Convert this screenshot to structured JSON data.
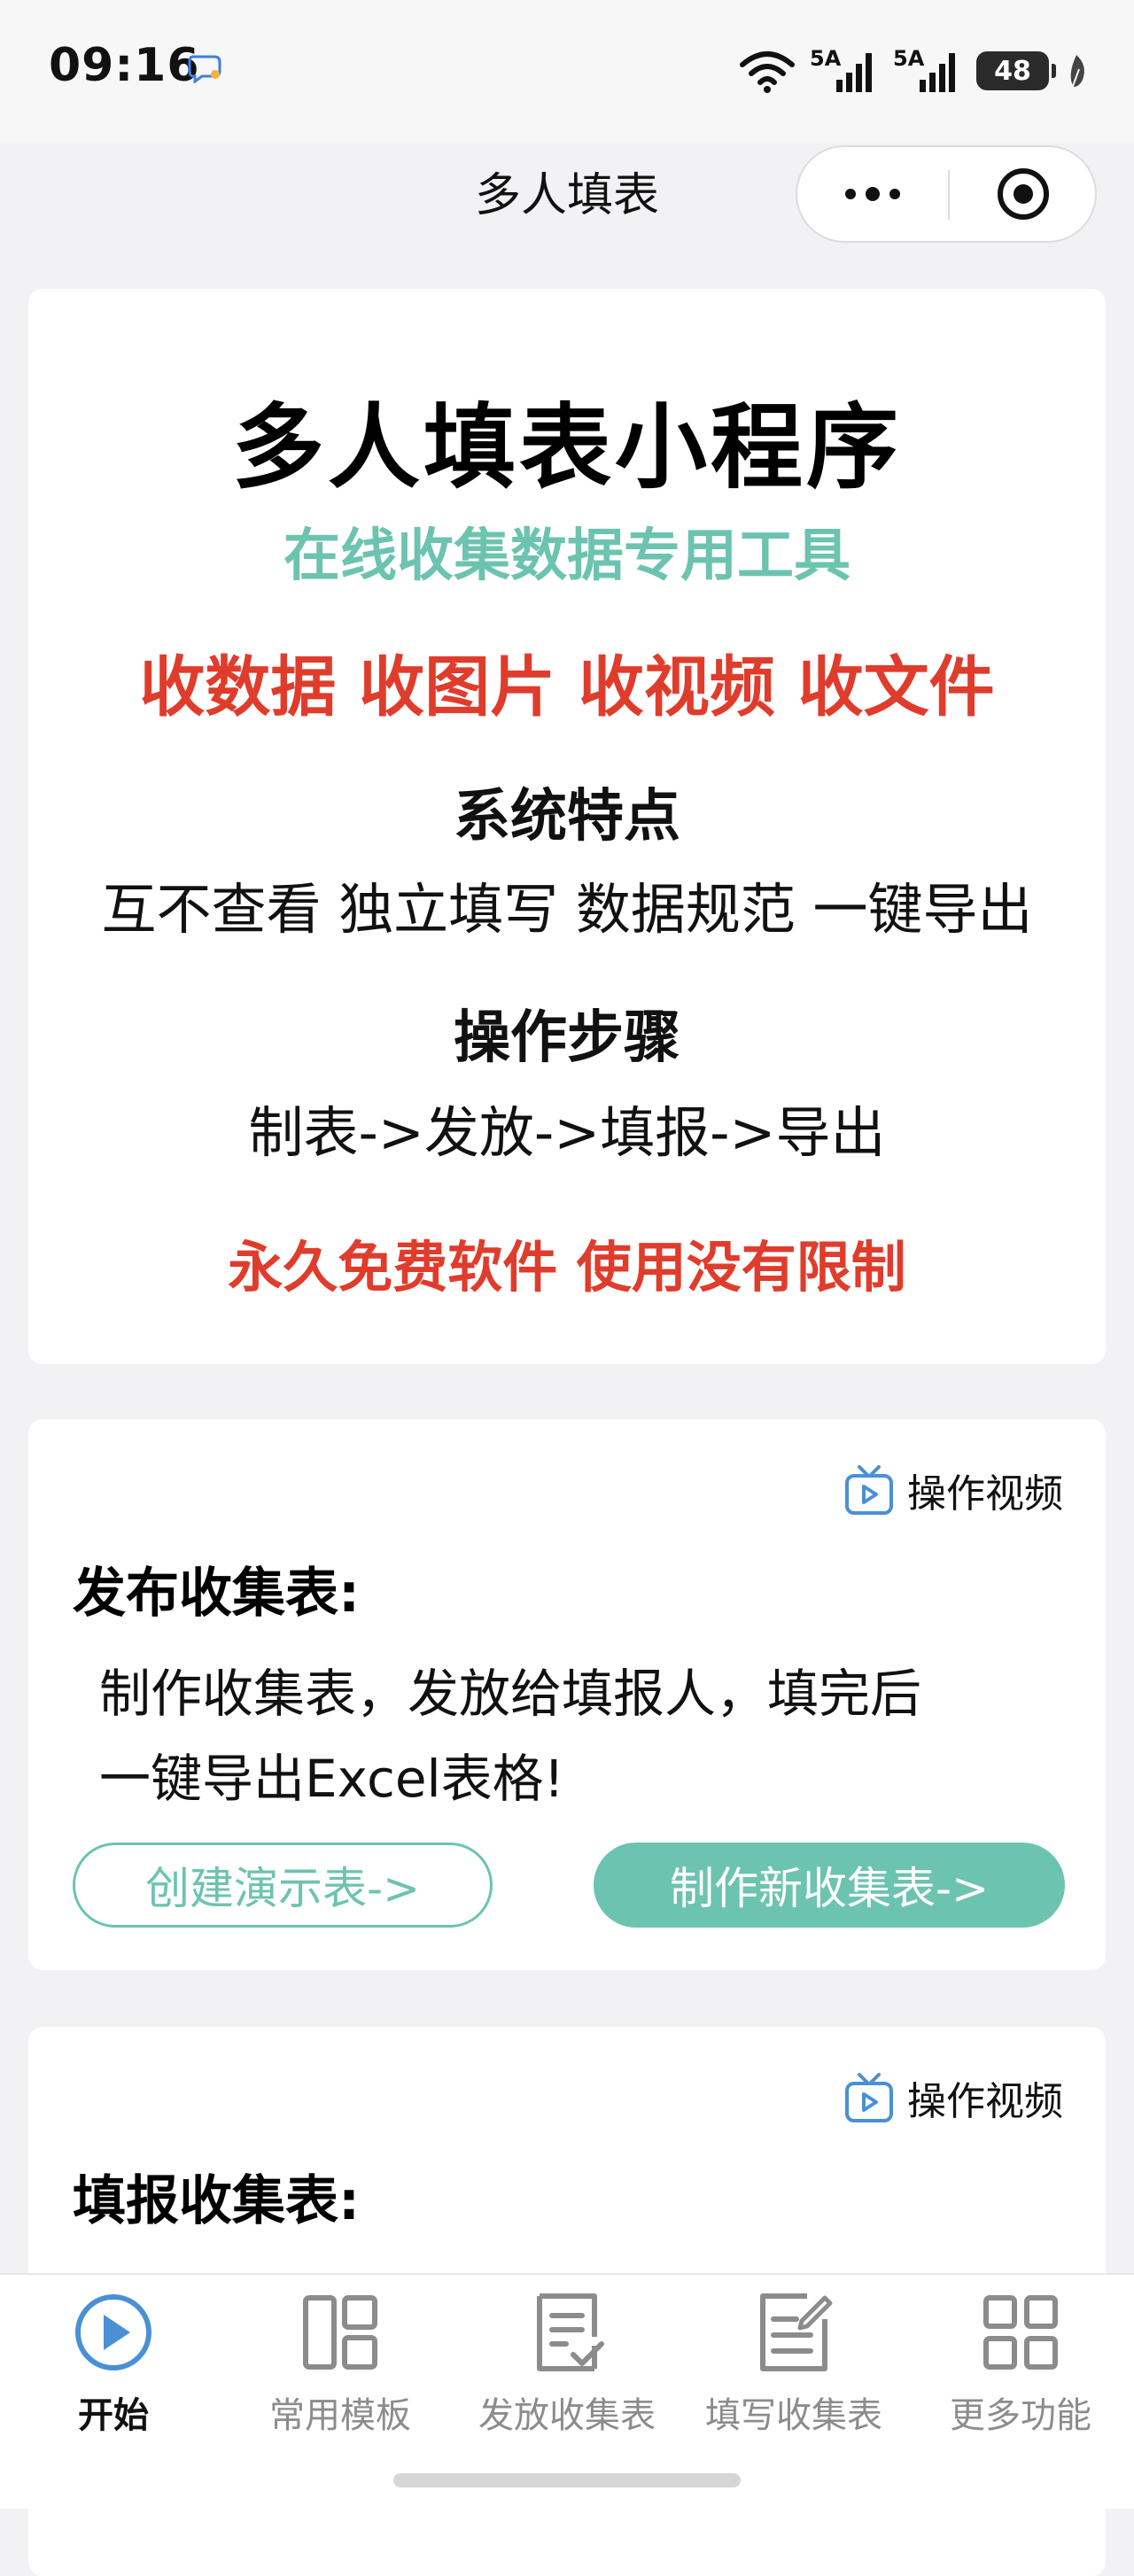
{
  "status_bar": {
    "time": "09:16",
    "signal_1": "5A",
    "signal_2": "5A",
    "battery": "48",
    "icons": [
      "message-bubble-icon",
      "wifi-icon",
      "signal-icon",
      "battery-icon",
      "leaf-icon"
    ]
  },
  "nav": {
    "title": "多人填表",
    "icons": [
      "more-dots-icon",
      "close-target-icon"
    ]
  },
  "intro": {
    "title": "多人填表小程序",
    "subtitle": "在线收集数据专用工具",
    "collect": "收数据 收图片 收视频 收文件",
    "features_heading": "系统特点",
    "features": "互不查看 独立填写 数据规范 一键导出",
    "steps_heading": "操作步骤",
    "steps": "制表->发放->填报->导出",
    "free": "永久免费软件 使用没有限制"
  },
  "publish": {
    "video_label": "操作视频",
    "heading": "发布收集表:",
    "desc_line1": "制作收集表，发放给填报人，填完后",
    "desc_line2": "一键导出Excel表格!",
    "demo_button": "创建演示表->",
    "new_button": "制作新收集表->"
  },
  "fill": {
    "video_label": "操作视频",
    "heading": "填报收集表:"
  },
  "tabs": [
    {
      "label": "开始",
      "icon": "play-circle-icon",
      "active": true
    },
    {
      "label": "常用模板",
      "icon": "template-grid-icon",
      "active": false
    },
    {
      "label": "发放收集表",
      "icon": "document-check-icon",
      "active": false
    },
    {
      "label": "填写收集表",
      "icon": "document-edit-icon",
      "active": false
    },
    {
      "label": "更多功能",
      "icon": "four-squares-icon",
      "active": false
    }
  ],
  "colors": {
    "accent_green": "#6cc3b0",
    "accent_red": "#e03c2c",
    "active_blue": "#4a90d6",
    "inactive_gray": "#8c8c8c"
  }
}
